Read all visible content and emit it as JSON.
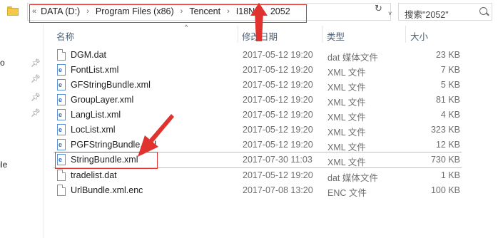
{
  "address": {
    "chevron": "«",
    "crumbs": [
      "DATA (D:)",
      "Program Files (x86)",
      "Tencent",
      "I18N",
      "2052"
    ],
    "separator": "›",
    "dropdown": "˅",
    "refresh": "↻"
  },
  "search": {
    "placeholder": "搜索\"2052\""
  },
  "columns": {
    "name": "名称",
    "date": "修改日期",
    "type": "类型",
    "size": "大小",
    "sort_indicator": "^"
  },
  "nav_fragments": [
    "o",
    "File"
  ],
  "files": [
    {
      "name": "DGM.dat",
      "date": "2017-05-12 19:20",
      "type": "dat 媒体文件",
      "size": "23 KB",
      "icon": "dat-file-icon"
    },
    {
      "name": "FontList.xml",
      "date": "2017-05-12 19:20",
      "type": "XML 文件",
      "size": "7 KB",
      "icon": "xml-file-icon"
    },
    {
      "name": "GFStringBundle.xml",
      "date": "2017-05-12 19:20",
      "type": "XML 文件",
      "size": "5 KB",
      "icon": "xml-file-icon"
    },
    {
      "name": "GroupLayer.xml",
      "date": "2017-05-12 19:20",
      "type": "XML 文件",
      "size": "81 KB",
      "icon": "xml-file-icon"
    },
    {
      "name": "LangList.xml",
      "date": "2017-05-12 19:20",
      "type": "XML 文件",
      "size": "4 KB",
      "icon": "xml-file-icon"
    },
    {
      "name": "LocList.xml",
      "date": "2017-05-12 19:20",
      "type": "XML 文件",
      "size": "323 KB",
      "icon": "xml-file-icon"
    },
    {
      "name": "PGFStringBundle.xml",
      "date": "2017-05-12 19:20",
      "type": "XML 文件",
      "size": "12 KB",
      "icon": "xml-file-icon"
    },
    {
      "name": "StringBundle.xml",
      "date": "2017-07-30 11:03",
      "type": "XML 文件",
      "size": "730 KB",
      "icon": "xml-file-icon",
      "selected": true
    },
    {
      "name": "tradelist.dat",
      "date": "2017-05-12 19:20",
      "type": "dat 媒体文件",
      "size": "1 KB",
      "icon": "dat-file-icon"
    },
    {
      "name": "UrlBundle.xml.enc",
      "date": "2017-07-08 13:20",
      "type": "ENC 文件",
      "size": "100 KB",
      "icon": "enc-file-icon"
    }
  ],
  "colors": {
    "annotation": "#e0322f",
    "selection": "#99c9ef"
  }
}
